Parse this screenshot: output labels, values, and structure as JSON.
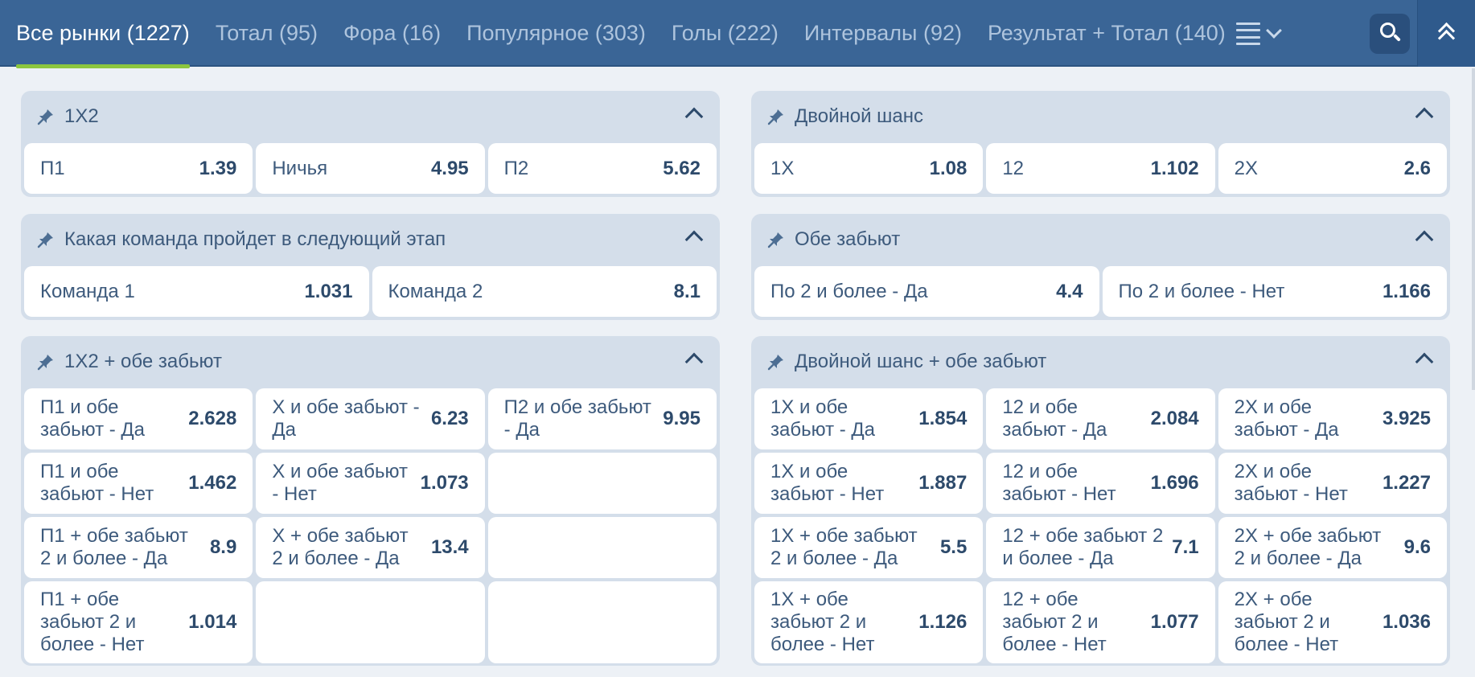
{
  "nav": {
    "tabs": [
      {
        "label": "Все рынки (1227)",
        "active": true
      },
      {
        "label": "Тотал (95)",
        "active": false
      },
      {
        "label": "Фора (16)",
        "active": false
      },
      {
        "label": "Популярное (303)",
        "active": false
      },
      {
        "label": "Голы (222)",
        "active": false
      },
      {
        "label": "Интервалы (92)",
        "active": false
      },
      {
        "label": "Результат + Тотал (140)",
        "active": false
      }
    ]
  },
  "groups": {
    "result": {
      "title": "1X2",
      "cells": [
        {
          "label": "П1",
          "odd": "1.39"
        },
        {
          "label": "Ничья",
          "odd": "4.95"
        },
        {
          "label": "П2",
          "odd": "5.62"
        }
      ]
    },
    "double_chance": {
      "title": "Двойной шанс",
      "cells": [
        {
          "label": "1Х",
          "odd": "1.08"
        },
        {
          "label": "12",
          "odd": "1.102"
        },
        {
          "label": "2Х",
          "odd": "2.6"
        }
      ]
    },
    "next_stage": {
      "title": "Какая команда пройдет в следующий этап",
      "cells": [
        {
          "label": "Команда 1",
          "odd": "1.031"
        },
        {
          "label": "Команда 2",
          "odd": "8.1"
        }
      ]
    },
    "both_score": {
      "title": "Обе забьют",
      "cells": [
        {
          "label": "По 2 и более - Да",
          "odd": "4.4"
        },
        {
          "label": "По 2 и более - Нет",
          "odd": "1.166"
        }
      ]
    },
    "result_both_score": {
      "title": "1X2 + обе забьют",
      "cells": [
        {
          "label": "П1 и обе забьют - Да",
          "odd": "2.628"
        },
        {
          "label": "Х и обе забьют - Да",
          "odd": "6.23"
        },
        {
          "label": "П2 и обе забьют - Да",
          "odd": "9.95"
        },
        {
          "label": "П1 и обе забьют - Нет",
          "odd": "1.462"
        },
        {
          "label": "Х и обе забьют - Нет",
          "odd": "1.073"
        },
        {
          "label": "",
          "odd": ""
        },
        {
          "label": "П1 + обе забьют 2 и более - Да",
          "odd": "8.9"
        },
        {
          "label": "Х + обе забьют 2 и более - Да",
          "odd": "13.4"
        },
        {
          "label": "",
          "odd": ""
        },
        {
          "label": "П1 + обе забьют 2 и более - Нет",
          "odd": "1.014"
        },
        {
          "label": "",
          "odd": ""
        },
        {
          "label": "",
          "odd": ""
        }
      ]
    },
    "double_chance_both_score": {
      "title": "Двойной шанс + обе забьют",
      "cells": [
        {
          "label": "1Х и обе забьют - Да",
          "odd": "1.854"
        },
        {
          "label": "12 и обе забьют - Да",
          "odd": "2.084"
        },
        {
          "label": "2Х и обе забьют - Да",
          "odd": "3.925"
        },
        {
          "label": "1Х и обе забьют - Нет",
          "odd": "1.887"
        },
        {
          "label": "12 и обе забьют - Нет",
          "odd": "1.696"
        },
        {
          "label": "2Х и обе забьют - Нет",
          "odd": "1.227"
        },
        {
          "label": "1Х + обе забьют 2 и более - Да",
          "odd": "5.5"
        },
        {
          "label": "12 + обе забьют 2 и более - Да",
          "odd": "7.1"
        },
        {
          "label": "2Х + обе забьют 2 и более - Да",
          "odd": "9.6"
        },
        {
          "label": "1Х + обе забьют 2 и более - Нет",
          "odd": "1.126"
        },
        {
          "label": "12 + обе забьют 2 и более - Нет",
          "odd": "1.077"
        },
        {
          "label": "2Х + обе забьют 2 и более - Нет",
          "odd": "1.036"
        }
      ]
    }
  },
  "icons": {
    "pin": "pin-icon",
    "collapse": "chevron-up-icon",
    "menu": "menu-icon",
    "search": "search-icon",
    "collapse_all": "double-chevron-up-icon"
  },
  "colors": {
    "nav_bg": "#3a6596",
    "active_underline": "#8cc63f",
    "group_bg": "#d4deea",
    "cell_bg": "#ffffff",
    "page_bg": "#edf1f6"
  }
}
